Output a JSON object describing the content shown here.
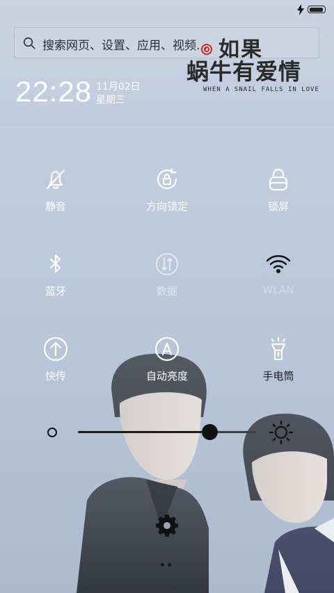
{
  "search": {
    "placeholder": "搜索网页、设置、应用、视频..."
  },
  "logo": {
    "line1": "如果",
    "line2": "蜗牛有爱情",
    "subtitle": "WHEN A SNAIL FALLS IN LOVE"
  },
  "clock": {
    "time": "22:28",
    "date": "11月02日",
    "weekday": "星期三"
  },
  "battery": {
    "level": 0.95
  },
  "toggles": [
    {
      "id": "mute",
      "label": "静音",
      "icon": "bell-off-icon",
      "state": "on"
    },
    {
      "id": "rotation_lock",
      "label": "方向锁定",
      "icon": "rotation-lock-icon",
      "state": "on"
    },
    {
      "id": "lock_screen",
      "label": "锁屏",
      "icon": "lock-icon",
      "state": "on"
    },
    {
      "id": "bluetooth",
      "label": "蓝牙",
      "icon": "bluetooth-icon",
      "state": "on"
    },
    {
      "id": "data",
      "label": "数据",
      "icon": "mobile-data-icon",
      "state": "disabled"
    },
    {
      "id": "wlan",
      "label": "WLAN",
      "icon": "wifi-icon",
      "state": "active"
    },
    {
      "id": "quick_share",
      "label": "快传",
      "icon": "upload-icon",
      "state": "on"
    },
    {
      "id": "auto_brightness",
      "label": "自动亮度",
      "icon": "auto-brightness-icon",
      "state": "on"
    },
    {
      "id": "flashlight",
      "label": "手电筒",
      "icon": "flashlight-icon",
      "state": "on"
    }
  ],
  "brightness": {
    "value": 0.74
  },
  "colors": {
    "icon_light": "#ffffff",
    "icon_dark": "#111111",
    "icon_disabled": "#e6ebf2"
  }
}
